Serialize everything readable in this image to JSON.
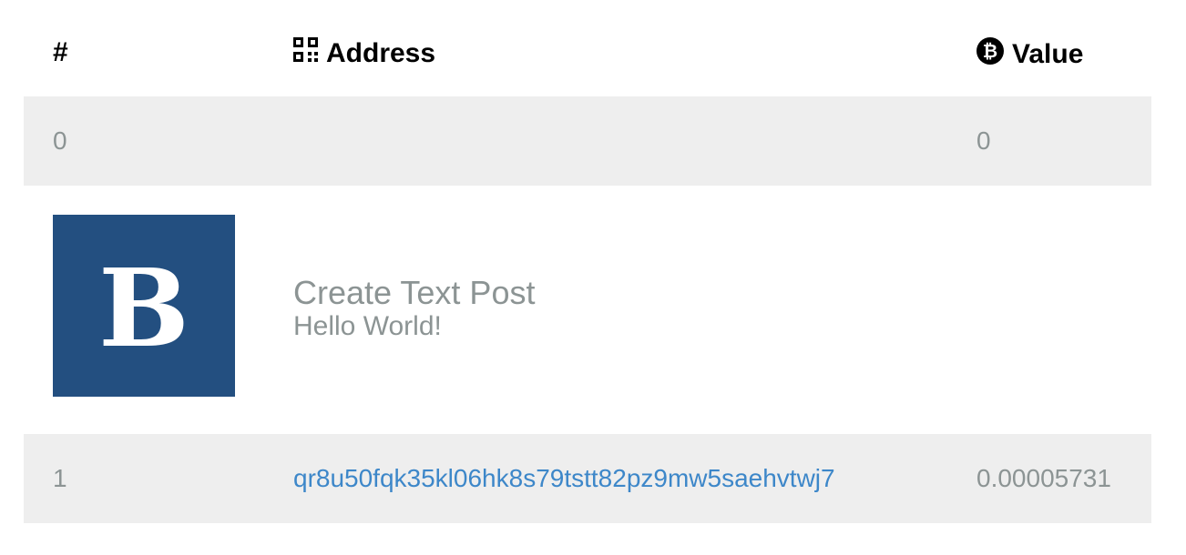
{
  "header": {
    "index_label": "#",
    "address_label": "Address",
    "value_label": "Value",
    "address_icon": "qr-code-icon",
    "value_icon": "bitcoin-icon"
  },
  "rows": [
    {
      "index": "0",
      "address": "",
      "value": "0"
    },
    {
      "index": "1",
      "address": "qr8u50fqk35kl06hk8s79tstt82pz9mw5saehvtwj7",
      "value": "0.00005731"
    }
  ],
  "op_return": {
    "logo_letter": "B",
    "logo_color": "#234f80",
    "title": "Create Text Post",
    "message": "Hello World!"
  },
  "colors": {
    "row_shade": "#eeeeee",
    "muted_text": "#8c9494",
    "link": "#3d87c9"
  }
}
